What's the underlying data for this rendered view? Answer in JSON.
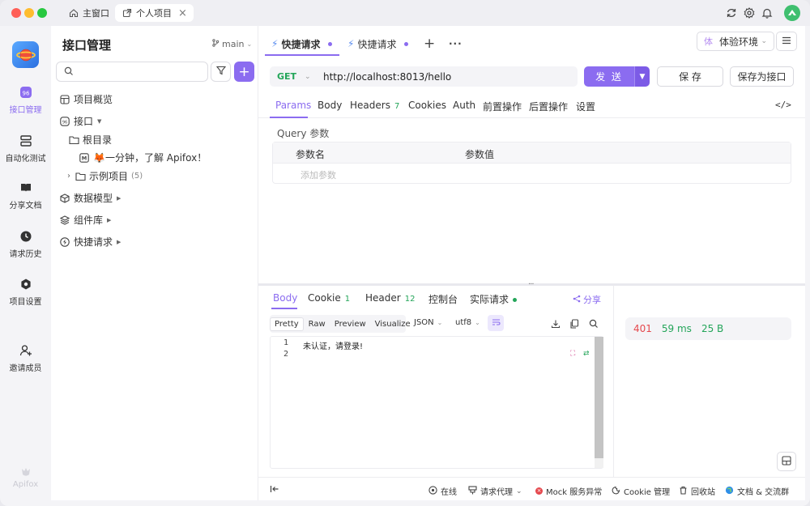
{
  "colors": {
    "accent": "#8b6cf0",
    "green": "#23a559",
    "red": "#e5484d",
    "close": "#ff5f57",
    "minimize": "#febc2e",
    "maximize": "#28c840"
  },
  "titlebar": {
    "tabs": [
      {
        "label": "主窗口",
        "icon": "home-icon"
      },
      {
        "label": "个人项目",
        "icon": "external-link-icon",
        "close": "×"
      }
    ]
  },
  "rail": {
    "items": [
      {
        "label": "接口管理",
        "icon": "api-icon"
      },
      {
        "label": "自动化测试",
        "icon": "automation-icon"
      },
      {
        "label": "分享文档",
        "icon": "book-icon"
      },
      {
        "label": "请求历史",
        "icon": "clock-icon"
      },
      {
        "label": "项目设置",
        "icon": "settings-icon"
      },
      {
        "label": "邀请成员",
        "icon": "add-user-icon"
      }
    ],
    "brand": "Apifox"
  },
  "sidebar": {
    "title": "接口管理",
    "branch": "main",
    "tree": [
      {
        "label": "项目概览",
        "icon": "overview-icon"
      },
      {
        "label": "接口",
        "icon": "api-icon"
      },
      {
        "label": "根目录",
        "icon": "folder-icon"
      },
      {
        "label": "🦊一分钟，了解 Apifox！",
        "icon": "markdown-icon"
      },
      {
        "label": "示例项目",
        "icon": "folder-icon",
        "count": "(5)"
      },
      {
        "label": "数据模型",
        "icon": "cube-icon"
      },
      {
        "label": "组件库",
        "icon": "layers-icon"
      },
      {
        "label": "快捷请求",
        "icon": "bolt-icon"
      }
    ]
  },
  "main": {
    "tabs": [
      {
        "label": "快捷请求"
      },
      {
        "label": "快捷请求"
      }
    ],
    "add": "+",
    "more": "···",
    "env": {
      "badge": "体",
      "label": "体验环境"
    },
    "request": {
      "method": "GET",
      "url": "http://localhost:8013/hello",
      "send": "发 送",
      "save": "保 存",
      "save_as": "保存为接口"
    },
    "req_tabs": [
      {
        "label": "Params"
      },
      {
        "label": "Body"
      },
      {
        "label": "Headers",
        "count": "7"
      },
      {
        "label": "Cookies"
      },
      {
        "label": "Auth"
      },
      {
        "label": "前置操作"
      },
      {
        "label": "后置操作"
      },
      {
        "label": "设置"
      }
    ],
    "code_toggle": "</>",
    "query": {
      "title": "Query 参数",
      "col_name": "参数名",
      "col_value": "参数值",
      "placeholder": "添加参数"
    }
  },
  "response": {
    "tabs": [
      {
        "label": "Body"
      },
      {
        "label": "Cookie",
        "count": "1"
      },
      {
        "label": "Header",
        "count": "12"
      },
      {
        "label": "控制台"
      },
      {
        "label": "实际请求"
      }
    ],
    "share": "分享",
    "formats": [
      "Pretty",
      "Raw",
      "Preview",
      "Visualize"
    ],
    "lang": "JSON",
    "encoding": "utf8",
    "lines": [
      {
        "no": "1",
        "text": "未认证，请登录!"
      },
      {
        "no": "2",
        "text": ""
      }
    ],
    "status": {
      "code": "401",
      "time": "59 ms",
      "size": "25 B"
    }
  },
  "footer": {
    "online": "在线",
    "proxy": "请求代理",
    "mock": "Mock 服务异常",
    "cookie": "Cookie 管理",
    "trash": "回收站",
    "docs": "文档 & 交流群"
  }
}
